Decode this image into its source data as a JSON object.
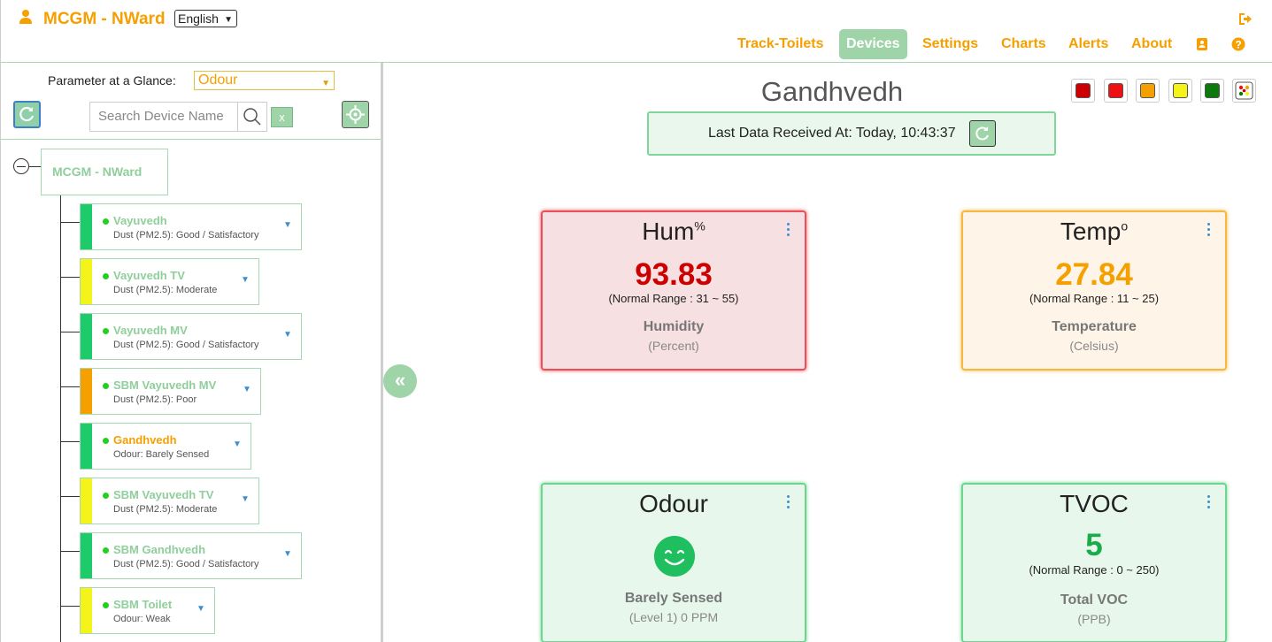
{
  "header": {
    "app_title": "MCGM - NWard",
    "language": "English",
    "nav": [
      {
        "label": "Track-Toilets"
      },
      {
        "label": "Devices"
      },
      {
        "label": "Settings"
      },
      {
        "label": "Charts"
      },
      {
        "label": "Alerts"
      },
      {
        "label": "About"
      }
    ]
  },
  "sidebar": {
    "param_label": "Parameter at a Glance:",
    "param_value": "Odour",
    "search_placeholder": "Search Device Name",
    "clear_label": "x",
    "root_name": "MCGM - NWard",
    "devices": [
      {
        "name": "Vayuvedh",
        "status": "Dust (PM2.5): Good / Satisfactory",
        "color": "#1ecb6a"
      },
      {
        "name": "Vayuvedh TV",
        "status": "Dust (PM2.5): Moderate",
        "color": "#f4f41a"
      },
      {
        "name": "Vayuvedh MV",
        "status": "Dust (PM2.5): Good / Satisfactory",
        "color": "#1ecb6a"
      },
      {
        "name": "SBM Vayuvedh MV",
        "status": "Dust (PM2.5): Poor",
        "color": "#f5a000"
      },
      {
        "name": "Gandhvedh",
        "status": "Odour: Barely Sensed",
        "color": "#1ecb6a",
        "selected": true
      },
      {
        "name": "SBM Vayuvedh TV",
        "status": "Dust (PM2.5): Moderate",
        "color": "#f4f41a"
      },
      {
        "name": "SBM Gandhvedh",
        "status": "Dust (PM2.5): Good / Satisfactory",
        "color": "#1ecb6a"
      },
      {
        "name": "SBM Toilet",
        "status": "Odour: Weak",
        "color": "#f4f41a"
      }
    ]
  },
  "main": {
    "device_title": "Gandhvedh",
    "last_data": "Last Data Received At: Today, 10:43:37",
    "legend_colors": [
      "#cc0000",
      "#ee1111",
      "#f5a000",
      "#f4f41a",
      "#0a7a0a"
    ],
    "cards": {
      "hum": {
        "title": "Hum",
        "sup": "%",
        "value": "93.83",
        "range": "(Normal Range : 31 ~ 55)",
        "name": "Humidity",
        "unit": "(Percent)",
        "value_color": "#cc0000"
      },
      "temp": {
        "title": "Temp",
        "sup": "o",
        "value": "27.84",
        "range": "(Normal Range : 11 ~ 25)",
        "name": "Temperature",
        "unit": "(Celsius)",
        "value_color": "#f5a000"
      },
      "odour": {
        "title": "Odour",
        "name": "Barely Sensed",
        "unit": "(Level 1) 0 PPM",
        "icon": "smiley-icon"
      },
      "tvoc": {
        "title": "TVOC",
        "value": "5",
        "range": "(Normal Range : 0 ~ 250)",
        "name": "Total VOC",
        "unit": "(PPB)",
        "value_color": "#1aab4a"
      }
    }
  }
}
